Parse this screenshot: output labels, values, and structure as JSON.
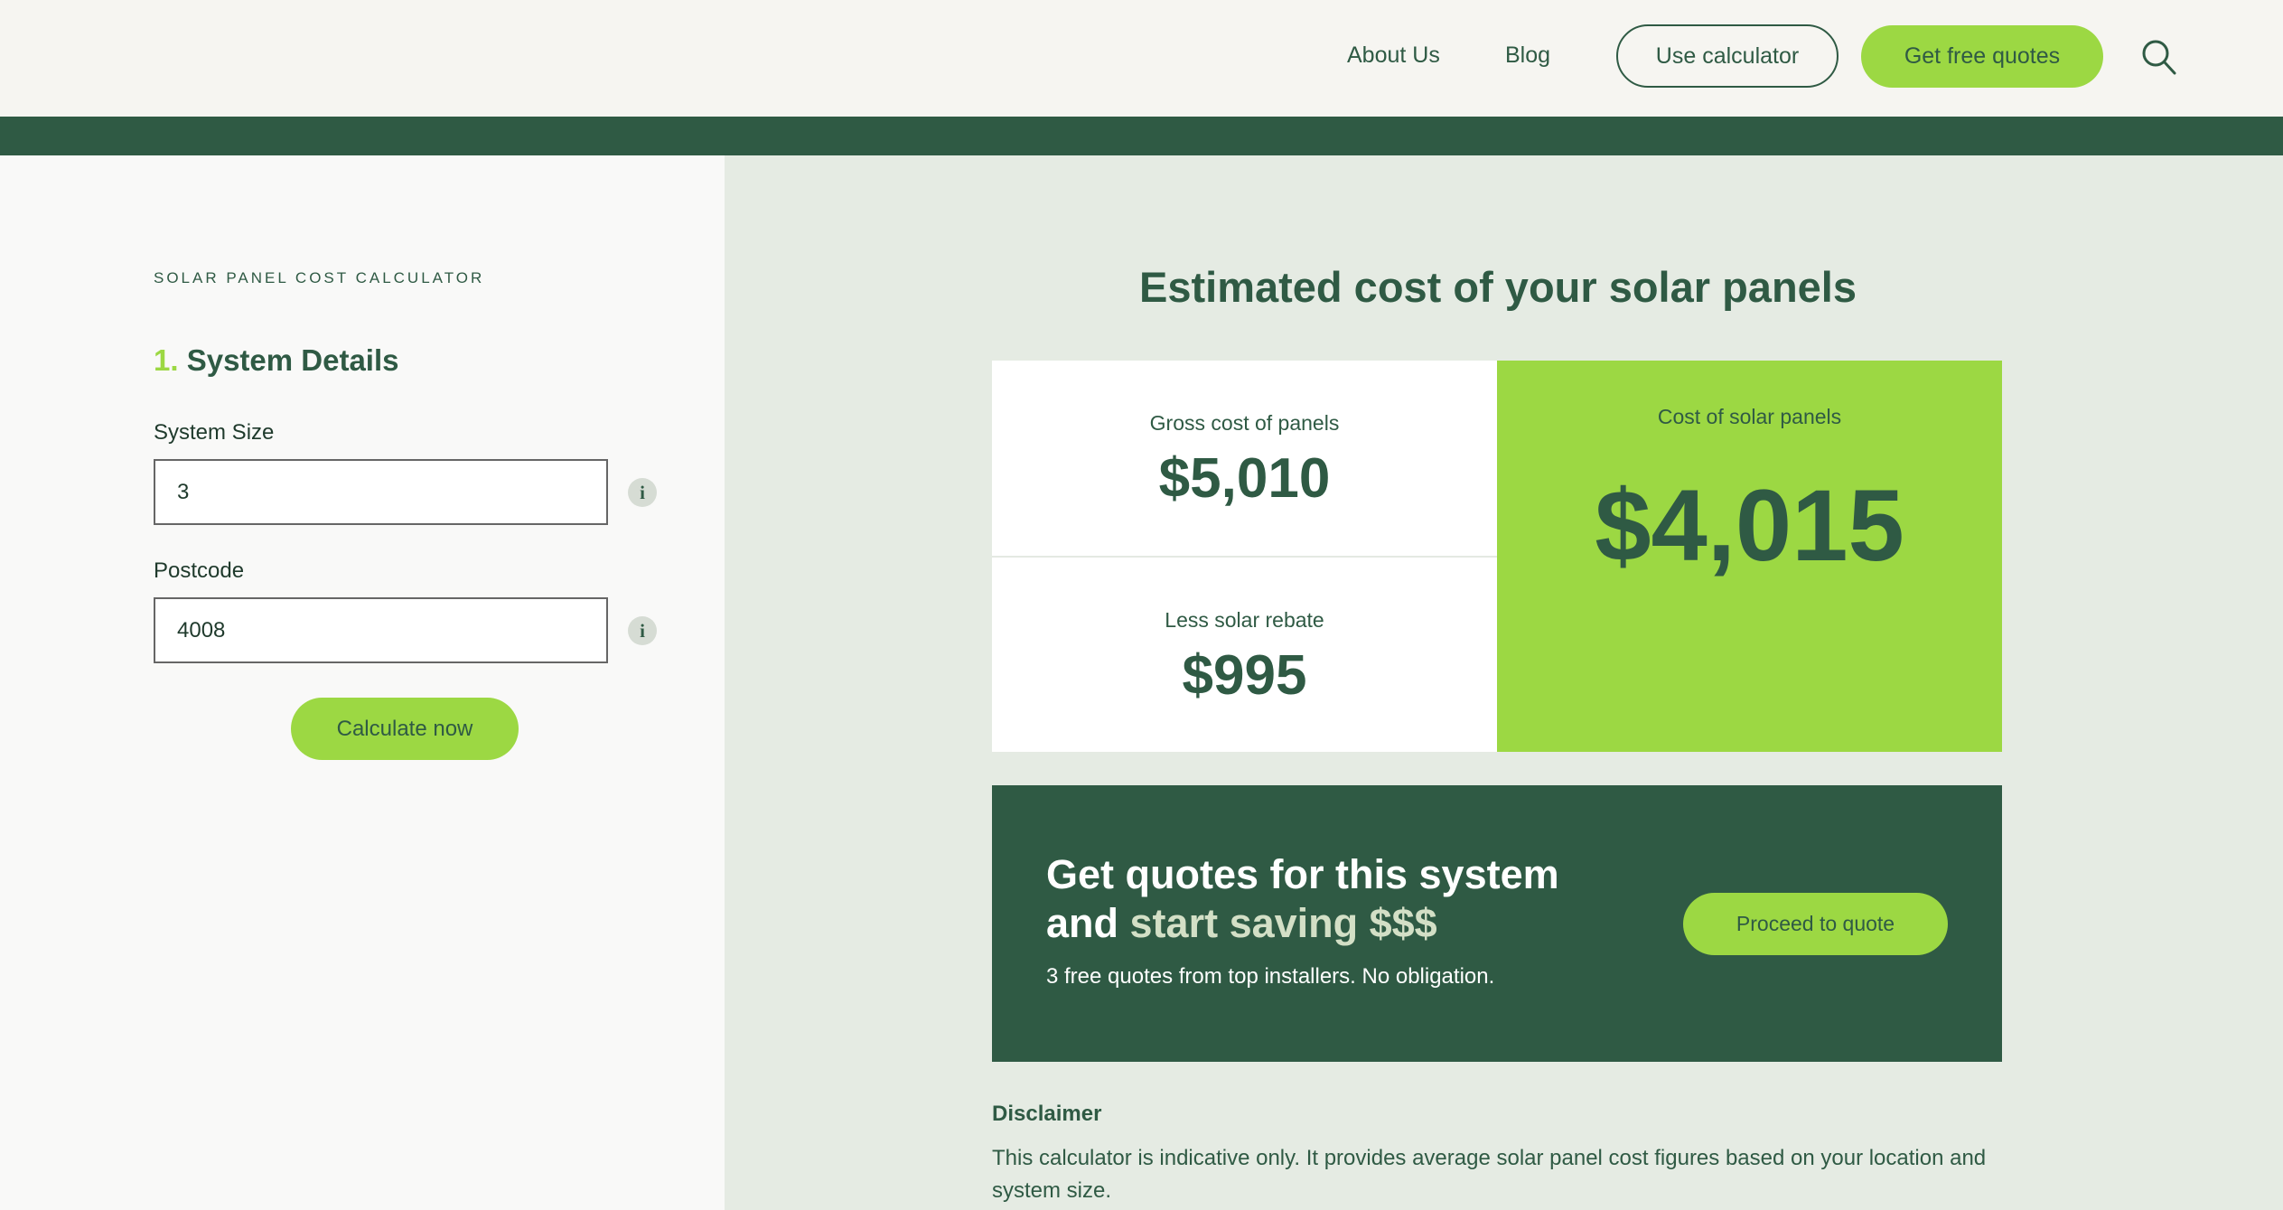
{
  "nav": {
    "about": "About Us",
    "blog": "Blog",
    "use_calculator": "Use calculator",
    "get_quotes": "Get free quotes",
    "search_icon": "search-icon"
  },
  "form": {
    "eyebrow": "SOLAR PANEL COST CALCULATOR",
    "step_number": "1.",
    "step_title": "System Details",
    "system_size_label": "System Size",
    "system_size_value": "3",
    "postcode_label": "Postcode",
    "postcode_value": "4008",
    "info_icon": "info-icon",
    "calculate_label": "Calculate now"
  },
  "results": {
    "title": "Estimated cost of your solar panels",
    "gross_label": "Gross cost of panels",
    "gross_value": "$5,010",
    "rebate_label": "Less solar rebate",
    "rebate_value": "$995",
    "total_label": "Cost of solar panels",
    "total_value": "$4,015"
  },
  "cta": {
    "heading_line1": "Get quotes for this system",
    "heading_and": "and",
    "heading_accent": "start saving $$$",
    "subtext": "3 free quotes from top installers. No obligation.",
    "button_label": "Proceed to quote"
  },
  "disclaimer": {
    "title": "Disclaimer",
    "text": "This calculator is indicative only. It provides average solar panel cost figures based on your location and system size."
  },
  "colors": {
    "brand_dark_green": "#2f5a44",
    "accent_lime": "#9cd843",
    "panel_bg": "#e5ebe3"
  }
}
